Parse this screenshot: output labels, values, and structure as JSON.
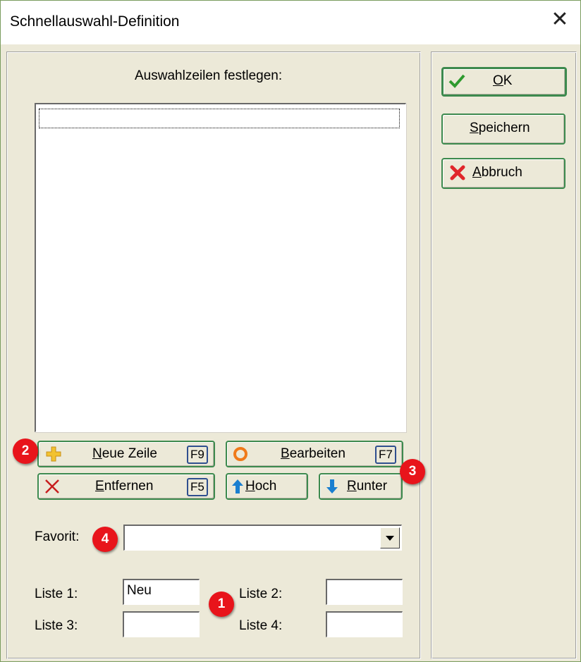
{
  "window": {
    "title": "Schnellauswahl-Definition",
    "close_glyph": "✕"
  },
  "left": {
    "heading": "Auswahlzeilen festlegen:",
    "buttons": {
      "neue_zeile": {
        "label_u": "N",
        "label_rest": "eue Zeile",
        "key": "F9",
        "icon": "plus-icon"
      },
      "bearbeiten": {
        "label_u": "B",
        "label_rest": "earbeiten",
        "key": "F7",
        "icon": "edit-ring-icon"
      },
      "entfernen": {
        "label_u": "E",
        "label_rest": "ntfernen",
        "key": "F5",
        "icon": "x-icon"
      },
      "hoch": {
        "label_u": "H",
        "label_rest": "och",
        "icon": "arrow-up-icon"
      },
      "runter": {
        "label_u": "R",
        "label_rest": "unter",
        "icon": "arrow-down-icon"
      }
    },
    "favorit": {
      "label": "Favorit:",
      "value": ""
    },
    "lists": {
      "liste1": {
        "label": "Liste 1:",
        "value": "Neu"
      },
      "liste2": {
        "label": "Liste 2:",
        "value": ""
      },
      "liste3": {
        "label": "Liste 3:",
        "value": ""
      },
      "liste4": {
        "label": "Liste 4:",
        "value": ""
      }
    }
  },
  "right": {
    "ok": {
      "label_u": "O",
      "label_rest": "K",
      "icon": "check-icon"
    },
    "speichern": {
      "label_u": "S",
      "label_rest": "peichern"
    },
    "abbruch": {
      "label_u": "A",
      "label_rest": "bbruch",
      "icon": "cancel-x-icon"
    }
  },
  "annotations": [
    "1",
    "2",
    "3",
    "4"
  ],
  "colors": {
    "button_border": "#3d8a4e",
    "badge": "#e8141b",
    "plus": "#f2c230",
    "ring": "#f07a1a",
    "arrow": "#1a7fd0",
    "check": "#2e9a2e",
    "cancel": "#e0262b"
  }
}
